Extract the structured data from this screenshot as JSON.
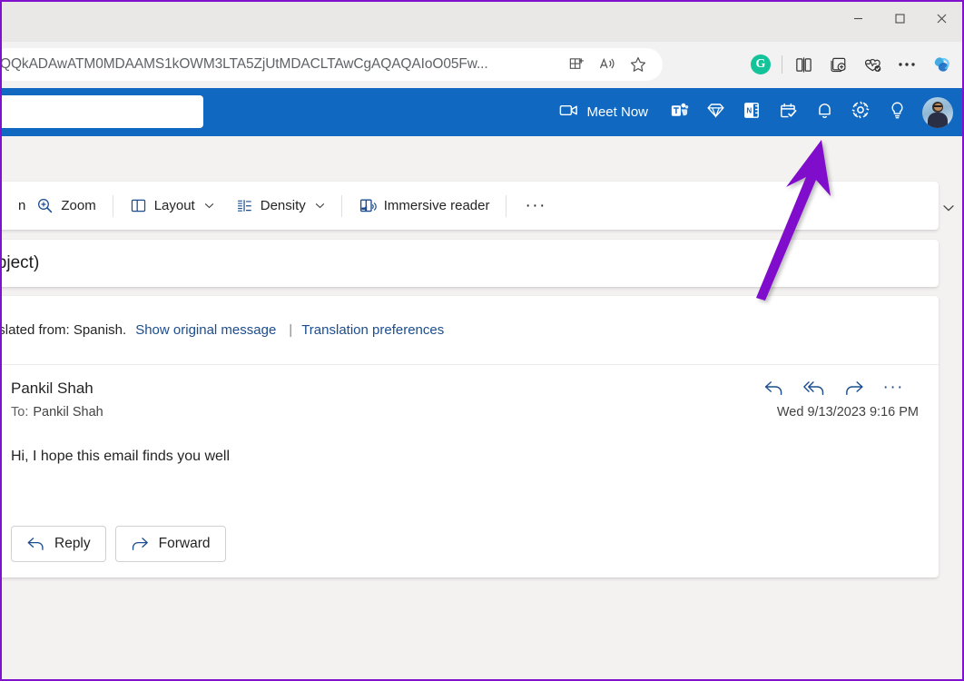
{
  "window": {
    "minimize_label": "Minimize",
    "maximize_label": "Maximize",
    "close_label": "Close"
  },
  "browser": {
    "url": "QQkADAwATM0MDAAMS1kOWM3LTA5ZjUtMDACLTAwCgAQAQAIoO05Fw...",
    "actions": [
      {
        "name": "split-screen-app-icon",
        "label": "Split screen"
      },
      {
        "name": "read-aloud-icon",
        "label": "Read aloud"
      },
      {
        "name": "favorites-star-icon",
        "label": "Add this page to favorites"
      },
      {
        "name": "grammarly-extension-icon",
        "label": "G"
      },
      {
        "name": "split-screen-icon",
        "label": "Split screen"
      },
      {
        "name": "collections-icon",
        "label": "Collections"
      },
      {
        "name": "browser-essentials-icon",
        "label": "Browser essentials"
      },
      {
        "name": "browser-settings-more-icon",
        "label": "Settings and more"
      },
      {
        "name": "copilot-icon",
        "label": "Copilot"
      }
    ]
  },
  "owa_header": {
    "search_placeholder": "",
    "search_value": "",
    "meet_now_label": "Meet Now",
    "items": [
      {
        "name": "meet-now-camera-icon",
        "label": "Meet Now"
      },
      {
        "name": "teams-icon",
        "label": "Teams"
      },
      {
        "name": "premium-diamond-icon",
        "label": "Microsoft 365"
      },
      {
        "name": "onenote-icon",
        "label": "OneNote"
      },
      {
        "name": "to-do-icon",
        "label": "To Do"
      },
      {
        "name": "notifications-bell-icon",
        "label": "Notifications"
      },
      {
        "name": "settings-gear-icon",
        "label": "Settings"
      },
      {
        "name": "tips-lightbulb-icon",
        "label": "Tips"
      },
      {
        "name": "account-avatar",
        "label": "Account manager"
      }
    ]
  },
  "reading_toolbar": {
    "cut_off_label": "n",
    "items": [
      {
        "name": "zoom-button",
        "label": "Zoom",
        "icon": "zoom-in-icon",
        "chevron": false
      },
      {
        "name": "layout-button",
        "label": "Layout",
        "icon": "layout-icon",
        "chevron": true
      },
      {
        "name": "density-button",
        "label": "Density",
        "icon": "density-icon",
        "chevron": true
      },
      {
        "name": "immersive-reader-button",
        "label": "Immersive reader",
        "icon": "immersive-reader-icon",
        "chevron": false
      }
    ],
    "more_label": "···"
  },
  "subject": {
    "text": "(no subject)"
  },
  "translation": {
    "static_text": "Translated from: Spanish.",
    "show_original_label": "Show original message",
    "separator": "|",
    "preferences_label": "Translation preferences"
  },
  "message": {
    "sender": "Pankil Shah",
    "to_label": "To:",
    "recipient": "Pankil Shah",
    "timestamp": "Wed 9/13/2023 9:16 PM",
    "body": "Hi, I hope this email finds you well",
    "actions": [
      {
        "name": "reply-icon",
        "label": "Reply"
      },
      {
        "name": "reply-all-icon",
        "label": "Reply all"
      },
      {
        "name": "forward-icon",
        "label": "Forward"
      },
      {
        "name": "more-actions-icon",
        "label": "···"
      }
    ],
    "reply_button_label": "Reply",
    "forward_button_label": "Forward"
  },
  "annotation": {
    "color": "#8011cc",
    "shape": "arrow",
    "points_to": "settings-gear-icon"
  },
  "colors": {
    "owa_blue": "#1168c0",
    "accent_link": "#1b4d8f",
    "annotation_purple": "#8011cc",
    "page_background": "#f3f2f1"
  }
}
